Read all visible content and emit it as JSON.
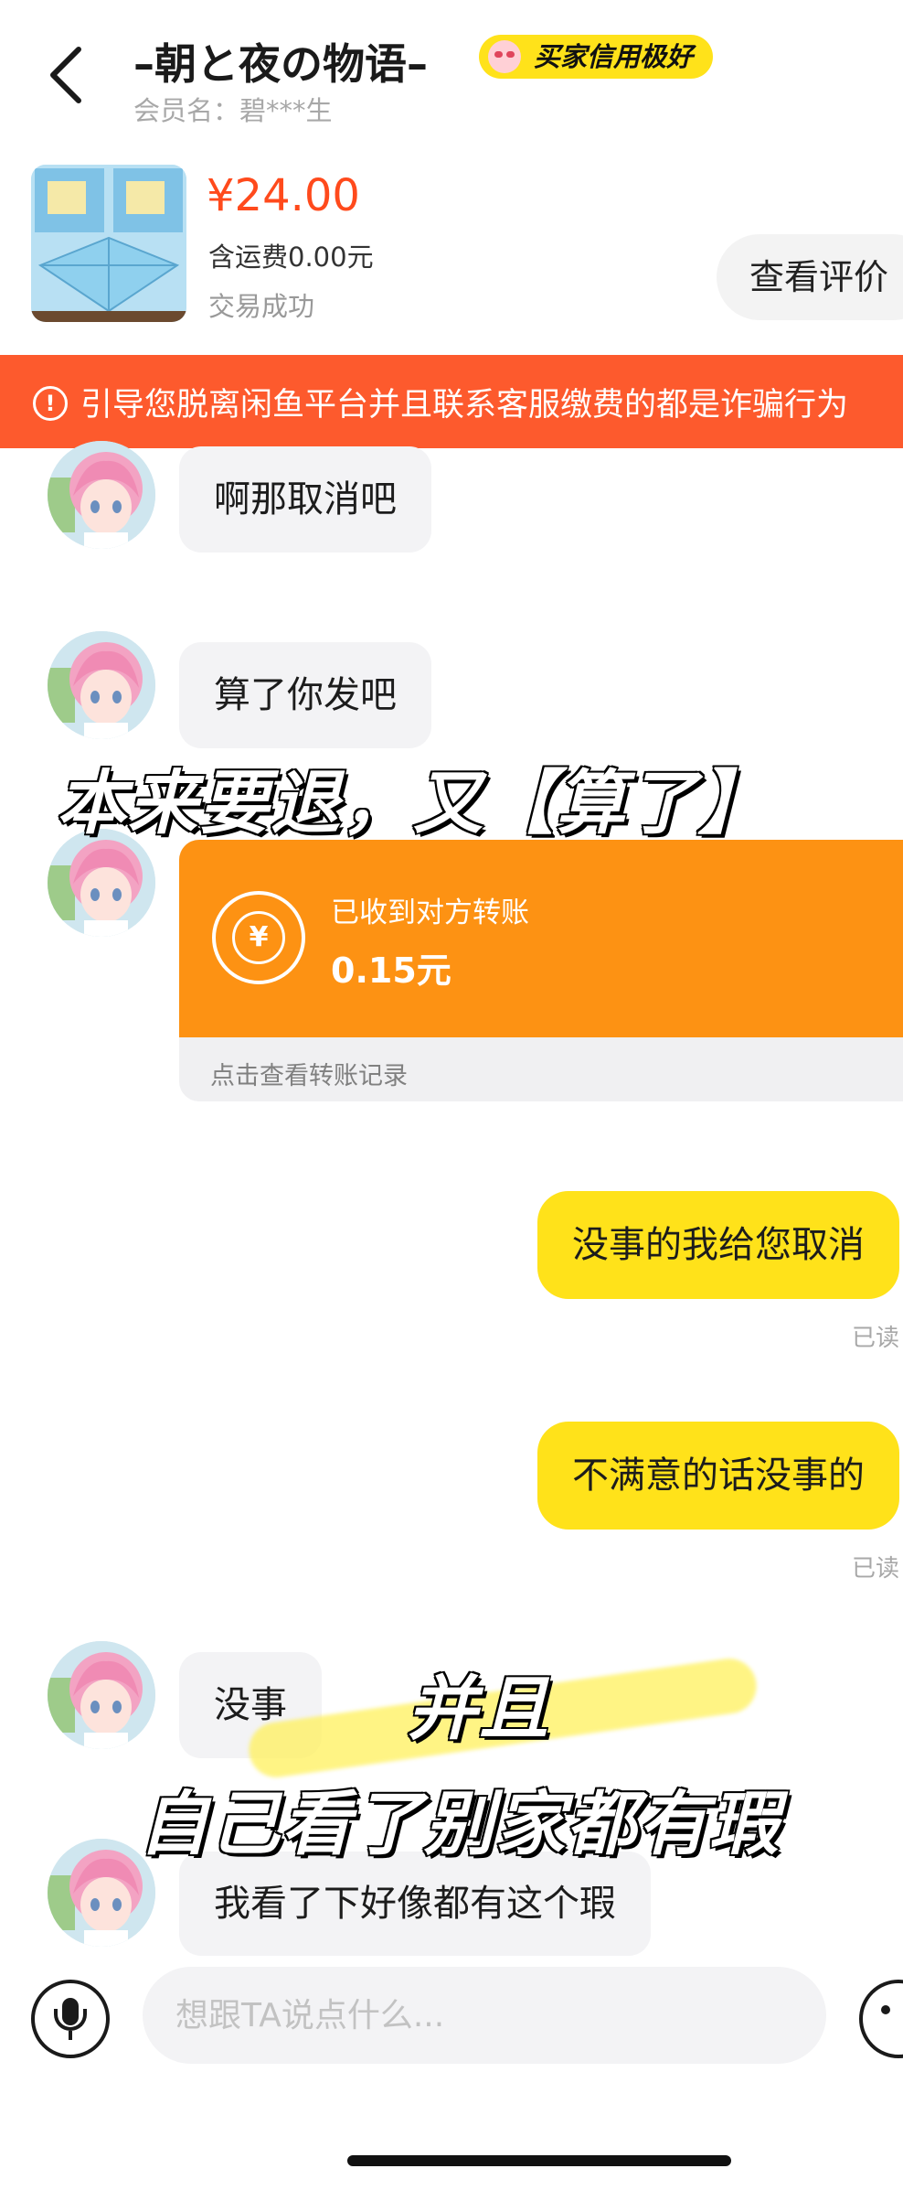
{
  "header": {
    "title": "–朝と夜の物语–",
    "badge": "买家信用极好",
    "member": "会员名：碧***生"
  },
  "product": {
    "price": "¥24.00",
    "shipping": "含运费0.00元",
    "status": "交易成功",
    "review_button": "查看评价"
  },
  "warning_banner": {
    "icon": "!",
    "text": "引导您脱离闲鱼平台并且联系客服缴费的都是诈骗行为"
  },
  "messages": [
    {
      "side": "left",
      "text": "啊那取消吧"
    },
    {
      "side": "left",
      "text": "算了你发吧"
    },
    {
      "side": "left",
      "type": "transfer",
      "label": "已收到对方转账",
      "amount": "0.15元",
      "link": "点击查看转账记录",
      "icon": "¥"
    },
    {
      "side": "right",
      "text": "没事的我给您取消",
      "read": "已读"
    },
    {
      "side": "right",
      "text": "不满意的话没事的",
      "read": "已读"
    },
    {
      "side": "left",
      "text": "没事"
    },
    {
      "side": "left",
      "text": "我看了下好像都有这个瑕"
    }
  ],
  "captions": {
    "line1": "本来要退，又【算了】",
    "line2": "并且",
    "line3": "自己看了别家都有瑕"
  },
  "input_bar": {
    "placeholder": "想跟TA说点什么..."
  },
  "icons": {
    "back": "chevron-left-icon",
    "warning": "alert-circle-icon",
    "transfer": "yen-exchange-icon",
    "mic": "microphone-icon",
    "emoji": "smiley-icon"
  },
  "colors": {
    "accent_yellow": "#ffe21a",
    "price_red": "#ff4a1c",
    "banner_orange": "#fd5a2d",
    "transfer_orange": "#fd9213"
  }
}
